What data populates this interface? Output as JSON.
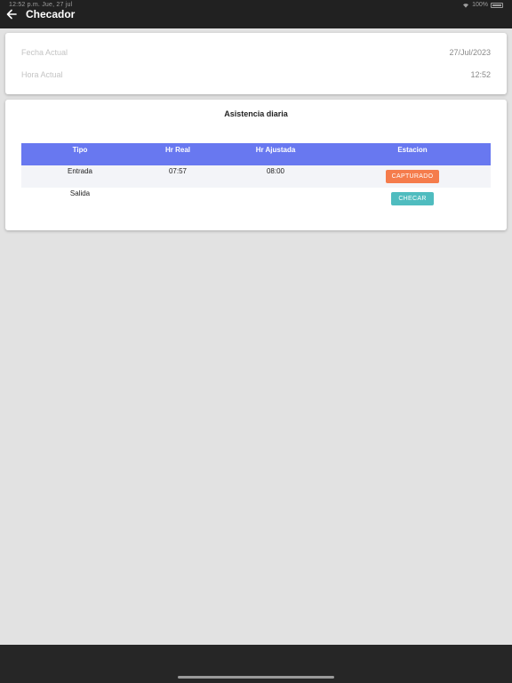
{
  "status_bar": {
    "time_date": "12:52 p.m.  Jue, 27 jul",
    "battery": "100%"
  },
  "header": {
    "title": "Checador"
  },
  "datetime_card": {
    "fecha_label": "Fecha Actual",
    "fecha_value": "27/Jul/2023",
    "hora_label": "Hora Actual",
    "hora_value": "12:52"
  },
  "attendance": {
    "title": "Asistencia diaria",
    "columns": [
      "Tipo",
      "Hr Real",
      "Hr Ajustada",
      "Estacion"
    ],
    "rows": [
      {
        "tipo": "Entrada",
        "hr_real": "07:57",
        "hr_ajustada": "08:00",
        "estacion": "CAPTURADO"
      },
      {
        "tipo": "Salida",
        "hr_real": "",
        "hr_ajustada": "",
        "estacion": "CHECAR"
      }
    ]
  },
  "colors": {
    "header_bg": "#212121",
    "table_header_bg": "#6878f0",
    "captured_badge": "#f57c4c",
    "check_button": "#4fbcbf",
    "page_bg": "#e2e2e2"
  }
}
